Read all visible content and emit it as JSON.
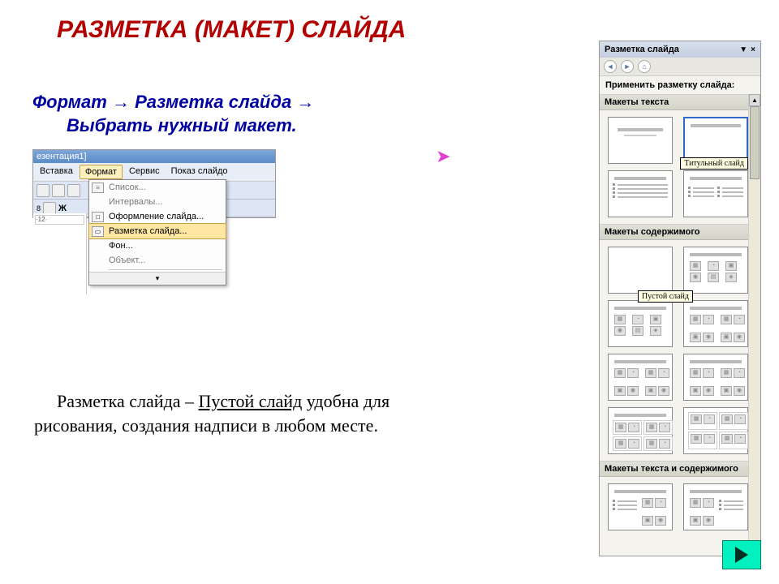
{
  "title": "РАЗМЕТКА (МАКЕТ) СЛАЙДА",
  "instruction": {
    "part1": "Формат",
    "arrow": "→",
    "part2": "Разметка слайда",
    "part3": "Выбрать нужный макет."
  },
  "menu_shot": {
    "titlebar": "езентация1]",
    "menubar": [
      "Вставка",
      "Формат",
      "Сервис",
      "Показ слайдо"
    ],
    "active_menu_index": 1,
    "toolbar_font_label": "Ж",
    "ruler_mark": "·12·",
    "dropdown": [
      {
        "icon": "≡",
        "label": "Список...",
        "enabled": false
      },
      {
        "icon": "",
        "label": "Интервалы...",
        "enabled": false
      },
      {
        "icon": "□",
        "label": "Оформление слайда...",
        "enabled": true
      },
      {
        "icon": "▭",
        "label": "Разметка слайда...",
        "enabled": true,
        "highlighted": true
      },
      {
        "icon": "",
        "label": "Фон...",
        "enabled": true
      },
      {
        "icon": "",
        "label": "Объект...",
        "enabled": false
      }
    ],
    "expand": "▾"
  },
  "body_text": {
    "line1a": "Разметка слайда –",
    "line1b": "Пустой слайд",
    "line2": "удобна для рисования, создания надписи в любом месте."
  },
  "pane": {
    "title": "Разметка слайда",
    "dropdown_icon": "▼",
    "close_icon": "×",
    "nav_back": "◄",
    "nav_fwd": "►",
    "nav_home": "⌂",
    "apply_label": "Применить разметку слайда:",
    "sections": {
      "text": "Макеты текста",
      "content": "Макеты содержимого",
      "text_content": "Макеты текста и содержимого"
    },
    "tooltips": {
      "title_slide": "Титульный слайд",
      "blank_slide": "Пустой слайд"
    }
  },
  "next_button": "▶"
}
